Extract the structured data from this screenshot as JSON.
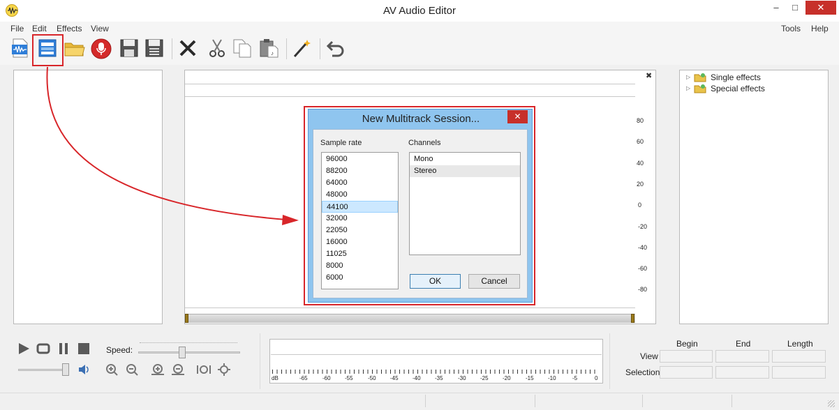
{
  "window": {
    "title": "AV Audio Editor",
    "minimize": "–",
    "maximize": "□",
    "close": "✕"
  },
  "menu": {
    "left": [
      "File",
      "Edit",
      "Effects",
      "View"
    ],
    "right": [
      "Tools",
      "Help"
    ]
  },
  "toolbar": {
    "icons": [
      "audio-file-icon",
      "new-multitrack-icon",
      "open-folder-icon",
      "record-icon",
      "save-icon",
      "save-as-icon",
      "delete-icon",
      "cut-icon",
      "copy-icon",
      "paste-icon",
      "magic-wand-icon",
      "undo-icon"
    ]
  },
  "waveform": {
    "close_label": "✖",
    "scale": [
      "80",
      "60",
      "40",
      "20",
      "0",
      "-20",
      "-40",
      "-60",
      "-80"
    ]
  },
  "effects_tree": {
    "items": [
      "Single effects",
      "Special effects"
    ]
  },
  "dialog": {
    "title": "New Multitrack Session...",
    "close": "✕",
    "sample_rate_label": "Sample rate",
    "sample_rates": [
      "96000",
      "88200",
      "64000",
      "48000",
      "44100",
      "32000",
      "22050",
      "16000",
      "11025",
      "8000",
      "6000"
    ],
    "selected_sample_rate": "44100",
    "channels_label": "Channels",
    "channels": [
      "Mono",
      "Stereo"
    ],
    "selected_channel": "Stereo",
    "ok_label": "OK",
    "cancel_label": "Cancel"
  },
  "transport": {
    "speed_label": "Speed:"
  },
  "meter": {
    "labels": [
      "dB",
      "-65",
      "-60",
      "-55",
      "-50",
      "-45",
      "-40",
      "-35",
      "-30",
      "-25",
      "-20",
      "-15",
      "-10",
      "-5",
      "0"
    ]
  },
  "selection_info": {
    "columns": [
      "Begin",
      "End",
      "Length"
    ],
    "rows": [
      "View",
      "Selection"
    ]
  }
}
